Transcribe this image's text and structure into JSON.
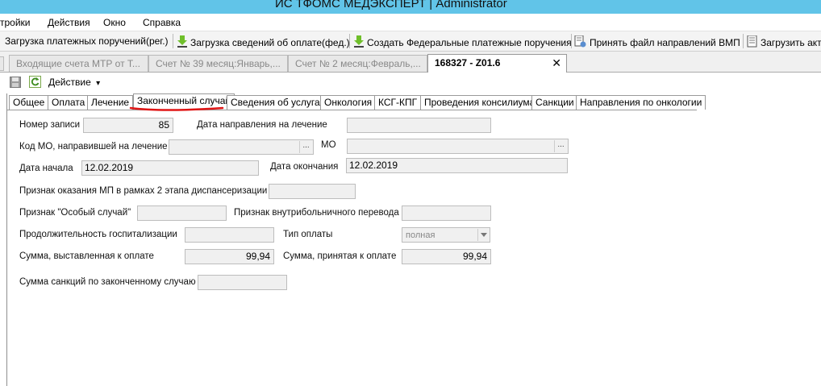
{
  "window": {
    "title": "ИС ТФОМС МЕДЭКСПЕРТ | Administrator"
  },
  "menu": {
    "items": [
      "тройки",
      "Действия",
      "Окно",
      "Справка"
    ]
  },
  "toolbar": {
    "items": [
      {
        "label": "Загрузка платежных поручений(рег.)",
        "icon": "none"
      },
      {
        "label": "Загрузка сведений об оплате(фед.)",
        "icon": "download-icon"
      },
      {
        "label": "Создать Федеральные платежные поручения",
        "icon": "download-icon"
      },
      {
        "label": "Принять файл направлений ВМП",
        "icon": "document-gear-icon"
      },
      {
        "label": "Загрузить акт",
        "icon": "document-icon"
      }
    ]
  },
  "doc_tabs": [
    {
      "label": "Входящие счета МТР от Т...",
      "active": false
    },
    {
      "label": "Счет № 39 месяц:Январь,...",
      "active": false
    },
    {
      "label": "Счет № 2 месяц:Февраль,...",
      "active": false
    },
    {
      "label": "168327 - Z01.6",
      "active": true,
      "close": "✕"
    }
  ],
  "actions": {
    "label": "Действие",
    "caret": "▾"
  },
  "form_tabs": [
    "Общее",
    "Оплата",
    "Лечение",
    "Законченный случай",
    "Сведения об услугах",
    "Онкология",
    "КСГ-КПГ",
    "Проведения консилиума",
    "Санкции",
    "Направления по онкологии"
  ],
  "active_form_tab": "Законченный случай",
  "fields": {
    "record_no_label": "Номер записи",
    "record_no_value": "85",
    "referral_date_label": "Дата направления на лечение",
    "referral_date_value": "",
    "mo_ref_label": "Код МО, направившей на лечение",
    "mo_ref_value": "",
    "mo_label": "МО",
    "mo_value": "",
    "start_date_label": "Дата начала",
    "start_date_value": "12.02.2019",
    "end_date_label": "Дата окончания",
    "end_date_value": "12.02.2019",
    "dispensary_label": "Признак оказания МП в рамках 2 этапа диспансеризации",
    "dispensary_value": "",
    "special_case_label": "Признак \"Особый случай\"",
    "special_case_value": "",
    "transfer_label": "Признак внутрибольничного перевода",
    "transfer_value": "",
    "duration_label": "Продолжительность госпитализации",
    "duration_value": "",
    "pay_type_label": "Тип оплаты",
    "pay_type_value": "полная",
    "sum_billed_label": "Сумма, выставленная к оплате",
    "sum_billed_value": "99,94",
    "sum_accepted_label": "Сумма, принятая к оплате",
    "sum_accepted_value": "99,94",
    "sanctions_label": "Сумма санкций по законченному случаю",
    "sanctions_value": "",
    "ellipsis": "..."
  },
  "colors": {
    "titlebar": "#61c4e8",
    "annotation": "#e01515",
    "field_bg": "#f0f0f0"
  }
}
